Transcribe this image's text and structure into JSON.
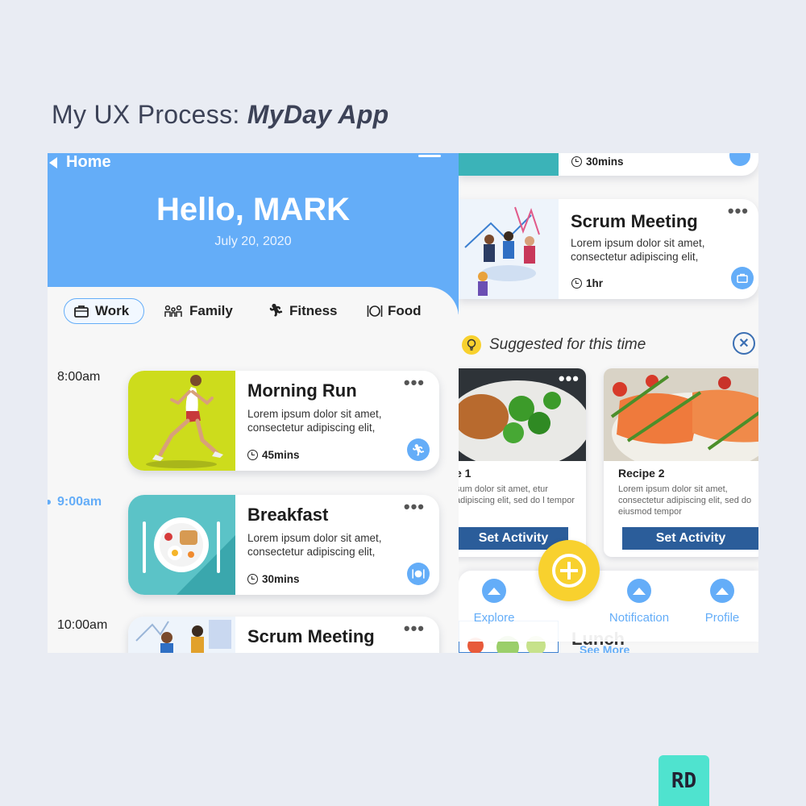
{
  "page": {
    "title_prefix": "My UX Process: ",
    "title_emphasis": "MyDay App"
  },
  "left_screen": {
    "nav_back_label": "Home",
    "greeting": "Hello, MARK",
    "date": "July 20, 2020",
    "tabs": [
      {
        "label": "Work",
        "icon": "briefcase-icon",
        "active": true
      },
      {
        "label": "Family",
        "icon": "family-icon",
        "active": false
      },
      {
        "label": "Fitness",
        "icon": "runner-icon",
        "active": false
      },
      {
        "label": "Food",
        "icon": "plate-cutlery-icon",
        "active": false
      }
    ],
    "times": [
      "8:00am",
      "9:00am",
      "10:00am"
    ],
    "current_time": "9:00am",
    "activities": [
      {
        "title": "Morning Run",
        "description": "Lorem ipsum dolor sit amet, consectetur adipiscing elit,",
        "duration": "45mins",
        "badge_icon": "runner-icon"
      },
      {
        "title": "Breakfast",
        "description": "Lorem ipsum dolor sit amet, consectetur adipiscing elit,",
        "duration": "30mins",
        "badge_icon": "plate-cutlery-icon"
      },
      {
        "title": "Scrum Meeting",
        "description": "",
        "duration": "",
        "badge_icon": ""
      }
    ]
  },
  "right_screen": {
    "top_card_duration": "30mins",
    "meeting_card": {
      "title": "Scrum Meeting",
      "description": "Lorem ipsum dolor sit amet, consectetur adipiscing elit,",
      "duration": "1hr",
      "badge_icon": "briefcase-icon"
    },
    "suggested_label": "Suggested for this time",
    "recipes": [
      {
        "name": "e 1",
        "description": "sum dolor sit amet, etur adipiscing elit, sed do l tempor",
        "button": "Set Activity"
      },
      {
        "name": "Recipe 2",
        "description": "Lorem ipsum dolor sit amet, consectetur adipiscing elit, sed do eiusmod tempor",
        "button": "Set Activity"
      }
    ],
    "nav": [
      {
        "label": "Explore",
        "icon": "mountain-icon"
      },
      {
        "label": "Notification",
        "icon": "mountain-icon"
      },
      {
        "label": "Profile",
        "icon": "mountain-icon"
      }
    ],
    "behind_text_1": "Lunch",
    "behind_text_2": "See More"
  },
  "logo_text": "RD",
  "colors": {
    "primary_blue": "#64adf8",
    "accent_yellow": "#f8d12e",
    "button_navy": "#2b5d9a",
    "logo_teal": "#4fe3cf"
  }
}
